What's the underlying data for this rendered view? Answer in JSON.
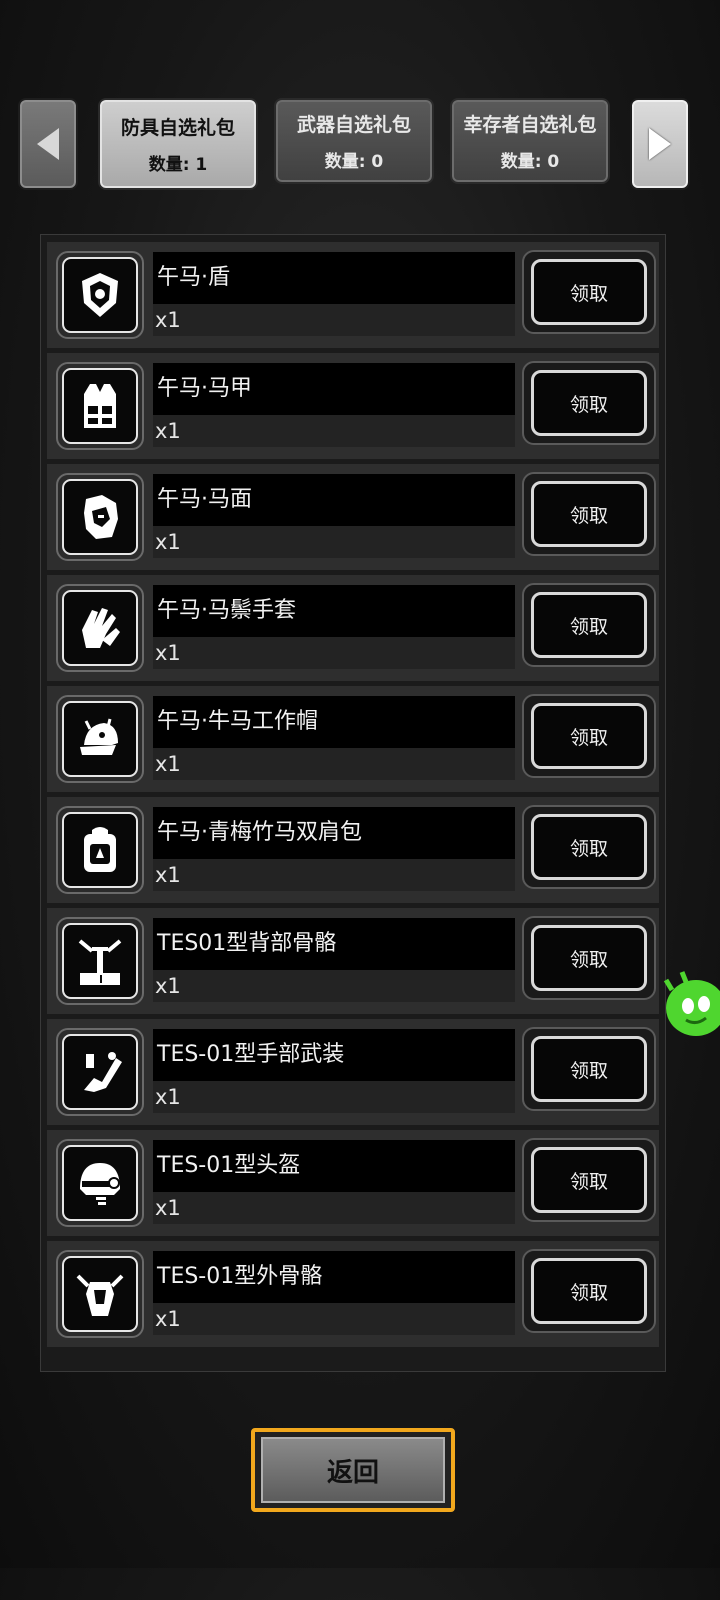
{
  "tabs": [
    {
      "title": "防具自选礼包",
      "count": "数量: 1",
      "active": true
    },
    {
      "title": "武器自选礼包",
      "count": "数量: 0",
      "active": false
    },
    {
      "title": "幸存者自选礼包",
      "count": "数量: 0",
      "active": false
    }
  ],
  "items": [
    {
      "name": "午马·盾",
      "qty": "x1",
      "button": "领取",
      "icon": "shield-icon"
    },
    {
      "name": "午马·马甲",
      "qty": "x1",
      "button": "领取",
      "icon": "vest-icon"
    },
    {
      "name": "午马·马面",
      "qty": "x1",
      "button": "领取",
      "icon": "horse-mask-icon"
    },
    {
      "name": "午马·马鬃手套",
      "qty": "x1",
      "button": "领取",
      "icon": "gloves-icon"
    },
    {
      "name": "午马·牛马工作帽",
      "qty": "x1",
      "button": "领取",
      "icon": "work-cap-icon"
    },
    {
      "name": "午马·青梅竹马双肩包",
      "qty": "x1",
      "button": "领取",
      "icon": "backpack-icon"
    },
    {
      "name": "TES01型背部骨骼",
      "qty": "x1",
      "button": "领取",
      "icon": "back-exoskeleton-icon"
    },
    {
      "name": "TES-01型手部武装",
      "qty": "x1",
      "button": "领取",
      "icon": "arm-weapon-icon"
    },
    {
      "name": "TES-01型头盔",
      "qty": "x1",
      "button": "领取",
      "icon": "helmet-icon"
    },
    {
      "name": "TES-01型外骨骼",
      "qty": "x1",
      "button": "领取",
      "icon": "exoskeleton-icon"
    }
  ],
  "back_button": "返回",
  "colors": {
    "accent_border": "#f2a81d",
    "row_bg": "#2e2e2e",
    "name_bg": "#000000"
  }
}
